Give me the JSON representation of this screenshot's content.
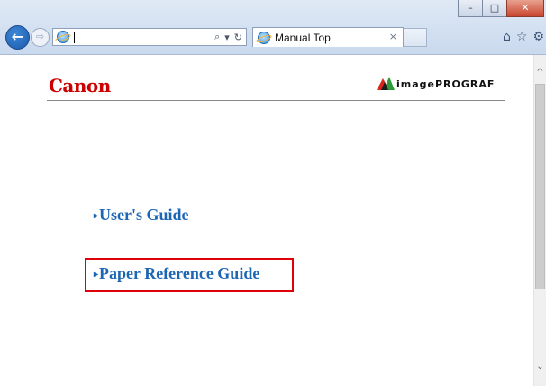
{
  "browser": {
    "window_controls": {
      "minimize": "–",
      "maximize": "□",
      "close": "✕"
    },
    "nav": {
      "back": "←",
      "forward": "⇨"
    },
    "address_bar": {
      "value": "",
      "search": "⌕",
      "dropdown": "▾",
      "refresh": "↻"
    },
    "tab": {
      "title": "Manual Top",
      "close": "×"
    },
    "toolbar": {
      "home": "⌂",
      "favorites": "☆",
      "settings": "⚙"
    }
  },
  "page": {
    "logo": "Canon",
    "brand": "imagePROGRAF",
    "links": [
      {
        "arrow": "▸",
        "label": "User's Guide"
      },
      {
        "arrow": "▸",
        "label": "Paper Reference Guide"
      }
    ],
    "highlight_color": "#e0000a",
    "link_color": "#1d66b4"
  },
  "scrollbar": {
    "up": "^",
    "down": "⌄"
  }
}
